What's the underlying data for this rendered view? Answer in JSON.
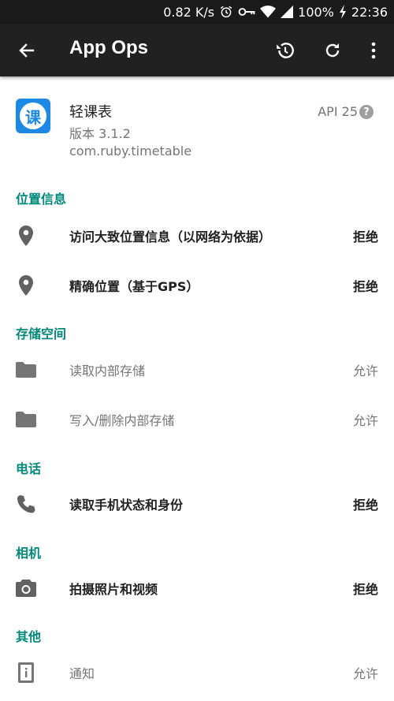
{
  "status_bar": {
    "speed": "0.82 K/s",
    "battery": "100%",
    "time": "22:36",
    "icons": [
      "alarm-icon",
      "key-icon",
      "wifi-icon",
      "signal-icon",
      "charging-icon"
    ]
  },
  "app_bar": {
    "title": "App Ops",
    "actions": [
      "back-arrow-icon",
      "restore-icon",
      "refresh-icon",
      "more-vert-icon"
    ]
  },
  "app_info": {
    "icon_char": "课",
    "name": "轻课表",
    "version": "版本 3.1.2",
    "package": "com.ruby.timetable",
    "api": "API 25",
    "help": "?"
  },
  "sections": [
    {
      "title": "位置信息",
      "items": [
        {
          "icon": "location-pin-icon",
          "label": "访问大致位置信息（以网络为依据）",
          "status": "拒绝"
        },
        {
          "icon": "location-pin-icon",
          "label": "精确位置（基于GPS）",
          "status": "拒绝"
        }
      ]
    },
    {
      "title": "存储空间",
      "items": [
        {
          "icon": "folder-icon",
          "label": "读取内部存储",
          "status": "允许"
        },
        {
          "icon": "folder-icon",
          "label": "写入/删除内部存储",
          "status": "允许"
        }
      ]
    },
    {
      "title": "电话",
      "items": [
        {
          "icon": "phone-icon",
          "label": "读取手机状态和身份",
          "status": "拒绝"
        }
      ]
    },
    {
      "title": "相机",
      "items": [
        {
          "icon": "camera-icon",
          "label": "拍摄照片和视频",
          "status": "拒绝"
        }
      ]
    },
    {
      "title": "其他",
      "items": [
        {
          "icon": "info-device-icon",
          "label": "通知",
          "status": "允许"
        }
      ]
    }
  ],
  "colors": {
    "section_accent": "#00897b",
    "app_bar": "#212121",
    "status_bar": "#1a1a1a",
    "app_icon": "#1e88e5"
  }
}
